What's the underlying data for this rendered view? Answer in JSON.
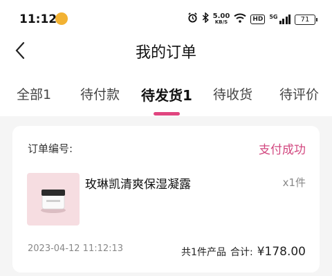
{
  "status_bar": {
    "time": "11:12",
    "net_speed_value": "5.00",
    "net_speed_unit": "KB/S",
    "hd_label": "HD",
    "signal_label": "5G",
    "battery": "71",
    "icons": [
      "app-emoji-icon",
      "alarm-icon",
      "bluetooth-icon",
      "wifi-icon",
      "signal-icon",
      "battery-icon"
    ]
  },
  "header": {
    "title": "我的订单",
    "back_icon": "chevron-left-icon"
  },
  "tabs": [
    {
      "label": "全部1",
      "active": false
    },
    {
      "label": "待付款",
      "active": false
    },
    {
      "label": "待发货1",
      "active": true
    },
    {
      "label": "待收货",
      "active": false
    },
    {
      "label": "待评价",
      "active": false
    }
  ],
  "order": {
    "number_label": "订单编号:",
    "status": "支付成功",
    "product": {
      "name": "玫琳凯清爽保湿凝露",
      "quantity": "x1件"
    },
    "date": "2023-04-12 11:12:13",
    "item_count": "共1件产品",
    "total_label": "合计:",
    "total": "¥178.00"
  },
  "colors": {
    "accent": "#e0457f",
    "status_text": "#d2477f",
    "page_bg": "#f5f5f5"
  }
}
